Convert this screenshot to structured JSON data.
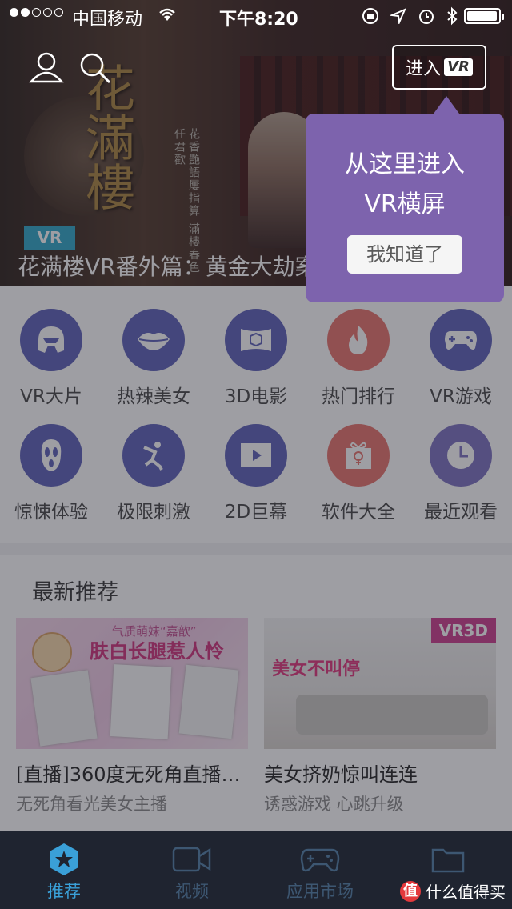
{
  "status_bar": {
    "carrier": "中国移动",
    "time": "下午8:20"
  },
  "banner": {
    "tag": "VR",
    "title": "花满楼VR番外篇：黄金大劫案",
    "enter_vr_text": "进入",
    "enter_vr_badge": "VR"
  },
  "tooltip": {
    "line1": "从这里进入",
    "line2": "VR横屏",
    "confirm": "我知道了"
  },
  "categories": [
    {
      "label": "VR大片",
      "color": "#5b5fb8",
      "icon": "helmet-icon"
    },
    {
      "label": "热辣美女",
      "color": "#5b5fb8",
      "icon": "lips-icon"
    },
    {
      "label": "3D电影",
      "color": "#5b5fb8",
      "icon": "cube-icon"
    },
    {
      "label": "热门排行",
      "color": "#e8716a",
      "icon": "flame-icon"
    },
    {
      "label": "VR游戏",
      "color": "#5b5fb8",
      "icon": "gamepad-icon"
    },
    {
      "label": "惊悚体验",
      "color": "#5b5fb8",
      "icon": "ghost-icon"
    },
    {
      "label": "极限刺激",
      "color": "#5b5fb8",
      "icon": "skier-icon"
    },
    {
      "label": "2D巨幕",
      "color": "#5b5fb8",
      "icon": "play-screen-icon"
    },
    {
      "label": "软件大全",
      "color": "#e8716a",
      "icon": "gift-icon"
    },
    {
      "label": "最近观看",
      "color": "#7a6fc0",
      "icon": "clock-icon"
    }
  ],
  "recommend": {
    "title": "最新推荐",
    "cards": [
      {
        "title": "[直播]360度无死角直播…",
        "subtitle": "无死角看光美女主播",
        "thumb_caption_top": "气质萌妹“嘉歆”",
        "thumb_caption": "肤白长腿惹人怜"
      },
      {
        "title": "美女挤奶惊叫连连",
        "subtitle": "诱惑游戏 心跳升级",
        "badge": "VR3D",
        "thumb_caption": "美女不叫停"
      }
    ]
  },
  "tabs": [
    {
      "label": "推荐",
      "icon": "star-hexagon-icon",
      "active": true
    },
    {
      "label": "视频",
      "icon": "video-camera-icon",
      "active": false
    },
    {
      "label": "应用市场",
      "icon": "gamepad-icon",
      "active": false
    },
    {
      "label": "",
      "icon": "folder-icon",
      "active": false
    }
  ],
  "watermark": {
    "icon_text": "值",
    "text": "什么值得买"
  },
  "colors": {
    "accent": "#3aa0d8",
    "tooltip_bg": "#7d63ad",
    "tabbar_bg": "#1f2430",
    "vr_tag": "#2da7c7"
  }
}
